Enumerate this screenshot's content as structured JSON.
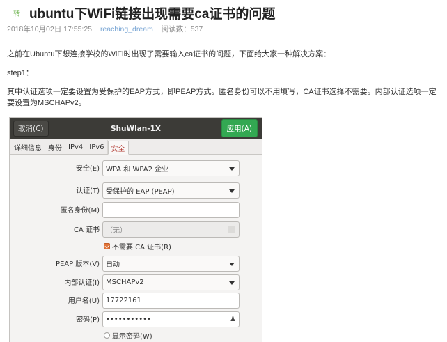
{
  "article": {
    "badge_text": "转",
    "title": "ubuntu下WiFi链接出现需要ca证书的问题",
    "meta": {
      "date": "2018年10月02日 17:55:25",
      "author": "reaching_dream",
      "reads": "阅读数：537"
    },
    "paragraphs": [
      "之前在Ubuntu下想连接学校的WiFi时出现了需要输入ca证书的问题，下面给大家一种解决方案：",
      "step1：",
      "其中认证选项一定要设置为受保护的EAP方式，即PEAP方式。匿名身份可以不用填写，CA证书选择不需要。内部认证选项一定要设置为MSCHAPv2。"
    ]
  },
  "dialog": {
    "cancel_label": "取消(C)",
    "title": "ShuWlan-1X",
    "apply_label": "应用(A)",
    "tabs": [
      "详细信息",
      "身份",
      "IPv4",
      "IPv6",
      "安全"
    ],
    "active_tab": "安全",
    "form": {
      "security_label": "安全(E)",
      "security_value": "WPA 和 WPA2 企业",
      "auth_label": "认证(T)",
      "auth_value": "受保护的 EAP (PEAP)",
      "anon_label": "匿名身份(M)",
      "anon_value": "",
      "ca_label": "CA 证书",
      "ca_value": "（无）",
      "no_ca_label": "不需要 CA 证书(R)",
      "peap_label": "PEAP 版本(V)",
      "peap_value": "自动",
      "inner_label": "内部认证(I)",
      "inner_value": "MSCHAPv2",
      "user_label": "用户名(U)",
      "user_value": "17722161",
      "pass_label": "密码(P)",
      "pass_value": "•••••••••••",
      "show_pass_label": "显示密码(W)"
    }
  },
  "colors": {
    "apply_green": "#33a852",
    "header_dark": "#3c3b37",
    "active_tab_red": "#b23a32",
    "checkbox_orange": "#e0743a",
    "author_blue": "#78a5d4"
  }
}
